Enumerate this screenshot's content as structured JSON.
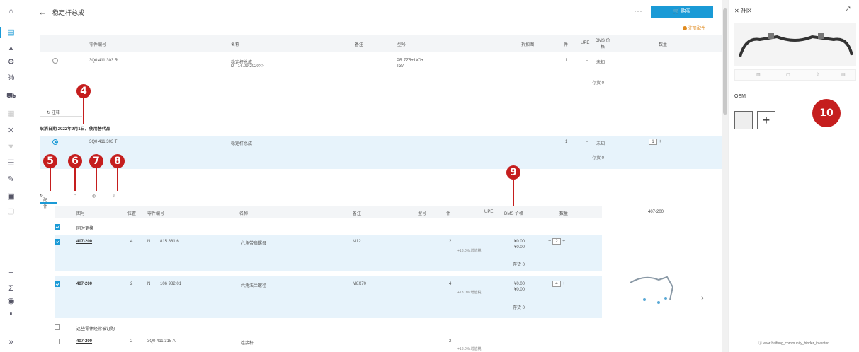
{
  "nav": {
    "icons": [
      "home-icon",
      "catalog-icon",
      "car-icon",
      "parts-icon",
      "filter-icon",
      "vehicle-icon",
      "grid-icon",
      "tools-icon",
      "bookmark-icon",
      "list-icon",
      "wrench-icon",
      "cart-icon",
      "doc-icon",
      "layers-icon",
      "tax-icon",
      "globe-icon",
      "chat-icon",
      "expand-icon"
    ]
  },
  "header": {
    "back": "←",
    "title": "稳定杆总成",
    "more": "···",
    "buy_label": "🛒 购买",
    "register": "注册配件"
  },
  "top_table": {
    "headers": [
      "零件编号",
      "名称",
      "备注",
      "型号",
      "折扣图",
      "件",
      "UPE",
      "DMS 价格",
      "数量"
    ],
    "row": {
      "part_no": "3Q0 411 303 R",
      "name": "稳定杆总成",
      "name_sub": "D - 14.09.2020>>",
      "remark": "",
      "model": "PR 7Z5+1X0+",
      "model_sub": "T37",
      "qty": "1",
      "upe": "-",
      "dms": "未知",
      "stock": "存货 0"
    }
  },
  "notes_tab": "注释",
  "cancel_text": "取消日期 2022年9月1日。使用替代品",
  "selected_row": {
    "part_no": "3Q0 411 303 T",
    "name": "稳定杆总成",
    "qty": "1",
    "upe": "-",
    "dms": "未知",
    "stock": "存货 0",
    "amount": "1"
  },
  "badges": {
    "b4": "4",
    "b5": "5",
    "b6": "6",
    "b7": "7",
    "b8": "8",
    "b9": "9",
    "b10": "10"
  },
  "toolbar": {
    "parts_tab": "配件",
    "icon2": "⌂",
    "icon3": "◎",
    "icon4": "⇩"
  },
  "sub_table": {
    "headers": [
      "图号",
      "位置",
      "零件编号",
      "名称",
      "备注",
      "型号",
      "件",
      "UPE",
      "DMS 价格",
      "数量"
    ],
    "group1": "同时更换",
    "rows": [
      {
        "fig": "407-200",
        "pos": "4",
        "n": "N",
        "part_no": "815 881 6",
        "name": "六角带肩螺母",
        "remark": "M12",
        "qty": "2",
        "upe_sub": "+13.0% 增值税",
        "price1": "¥0.00",
        "price2": "¥0.00",
        "stock": "存货 0",
        "amount": "2"
      },
      {
        "fig": "407-200",
        "pos": "2",
        "n": "N",
        "part_no": "106 982 01",
        "name": "六角法兰螺栓",
        "remark": "M8X70",
        "qty": "4",
        "upe_sub": "+13.0% 增值税",
        "price1": "¥0.00",
        "price2": "¥0.00",
        "stock": "存货 0",
        "amount": "4"
      }
    ],
    "group2": "这些零件经常被订购",
    "row3": {
      "fig": "407-200",
      "pos": "2",
      "part_no": "3Q0 411 315 A",
      "name": "连接杆",
      "qty": "2",
      "upe_sub": "+13.0% 增值税"
    },
    "figure_title": "407-200"
  },
  "panel": {
    "title": "社区",
    "oem_label": "OEM",
    "footer": "www.haifung_community_binder_inventor"
  },
  "colors": {
    "accent": "#1a9ad6",
    "badge": "#c51e1e",
    "highlight": "#e7f3fb",
    "warning": "#e08a1e"
  }
}
